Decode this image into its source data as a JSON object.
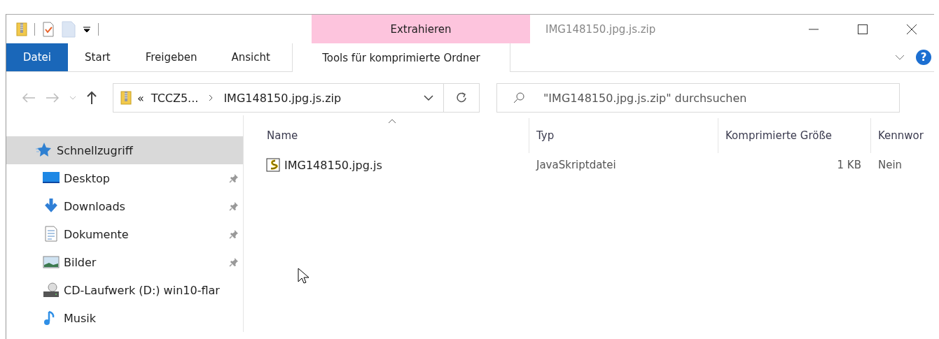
{
  "window": {
    "title": "IMG148150.jpg.js.zip",
    "context_group": "Extrahieren"
  },
  "ribbon_tabs": [
    {
      "label": "Datei",
      "kind": "file"
    },
    {
      "label": "Start",
      "kind": "normal"
    },
    {
      "label": "Freigeben",
      "kind": "normal"
    },
    {
      "label": "Ansicht",
      "kind": "normal"
    },
    {
      "label": "Tools für komprimierte Ordner",
      "kind": "contextual"
    }
  ],
  "help": {
    "label": "?"
  },
  "address_bar": {
    "overflow": "«",
    "segments": [
      "TCCZ5...",
      "IMG148150.jpg.js.zip"
    ]
  },
  "search": {
    "placeholder": "\"IMG148150.jpg.js.zip\" durchsuchen"
  },
  "sidebar": {
    "items": [
      {
        "label": "Schnellzugriff",
        "kind": "star",
        "selected": true,
        "pinned": false
      },
      {
        "label": "Desktop",
        "kind": "desktop",
        "selected": false,
        "pinned": true
      },
      {
        "label": "Downloads",
        "kind": "download",
        "selected": false,
        "pinned": true
      },
      {
        "label": "Dokumente",
        "kind": "document",
        "selected": false,
        "pinned": true
      },
      {
        "label": "Bilder",
        "kind": "picture",
        "selected": false,
        "pinned": true
      },
      {
        "label": "CD-Laufwerk (D:) win10-flar",
        "kind": "drive",
        "selected": false,
        "pinned": false
      },
      {
        "label": "Musik",
        "kind": "music",
        "selected": false,
        "pinned": false
      }
    ]
  },
  "table": {
    "columns": [
      "Name",
      "Typ",
      "Komprimierte Größe",
      "Kennwor"
    ],
    "rows": [
      {
        "cells": [
          "IMG148150.jpg.js",
          "JavaSkriptdatei",
          "1 KB",
          "Nein"
        ]
      }
    ]
  }
}
